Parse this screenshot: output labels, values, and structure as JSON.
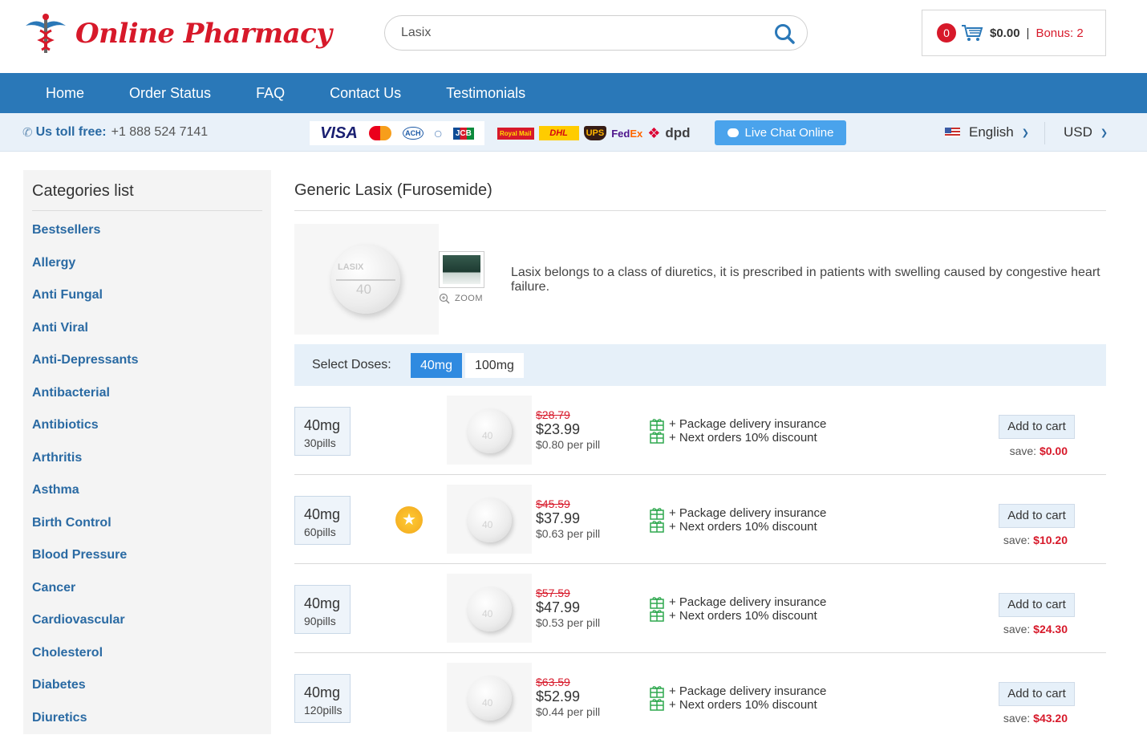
{
  "header": {
    "logo_text": "Online Pharmacy",
    "search": {
      "value": "Lasix"
    },
    "cart": {
      "count": "0",
      "total": "$0.00",
      "separator": "|",
      "bonus": "Bonus: 2"
    }
  },
  "nav": [
    "Home",
    "Order Status",
    "FAQ",
    "Contact Us",
    "Testimonials"
  ],
  "infobar": {
    "toll_label": "Us toll free:",
    "toll_number": "+1 888 524 7141",
    "payment_logos": [
      "VISA",
      "MasterCard",
      "ACH",
      "Diners Club",
      "JCB"
    ],
    "shipping_logos": [
      "Royal Mail",
      "DHL",
      "UPS",
      "FedEx Express",
      "dpd"
    ],
    "live_chat": "Live Chat Online",
    "language": "English",
    "currency": "USD"
  },
  "sidebar": {
    "title": "Categories list",
    "items": [
      "Bestsellers",
      "Allergy",
      "Anti Fungal",
      "Anti Viral",
      "Anti-Depressants",
      "Antibacterial",
      "Antibiotics",
      "Arthritis",
      "Asthma",
      "Birth Control",
      "Blood Pressure",
      "Cancer",
      "Cardiovascular",
      "Cholesterol",
      "Diabetes",
      "Diuretics"
    ]
  },
  "product": {
    "title": "Generic Lasix (Furosemide)",
    "pill_imprint": "LASIX",
    "pill_number": "40",
    "zoom_label": "ZOOM",
    "description": "Lasix belongs to a class of diuretics, it is prescribed in patients with swelling caused by congestive heart failure.",
    "doses_label": "Select Doses:",
    "doses": [
      "40mg",
      "100mg"
    ],
    "selected_dose": "40mg",
    "perk_1": "+ Package delivery insurance",
    "perk_2": "+ Next orders 10% discount",
    "add_to_cart": "Add to cart",
    "save_label": "save:",
    "packages": [
      {
        "dose": "40mg",
        "pills": "30pills",
        "old_price": "$28.79",
        "price": "$23.99",
        "per_pill": "$0.80 per pill",
        "save": "$0.00",
        "bestseller": false
      },
      {
        "dose": "40mg",
        "pills": "60pills",
        "old_price": "$45.59",
        "price": "$37.99",
        "per_pill": "$0.63 per pill",
        "save": "$10.20",
        "bestseller": true
      },
      {
        "dose": "40mg",
        "pills": "90pills",
        "old_price": "$57.59",
        "price": "$47.99",
        "per_pill": "$0.53 per pill",
        "save": "$24.30",
        "bestseller": false
      },
      {
        "dose": "40mg",
        "pills": "120pills",
        "old_price": "$63.59",
        "price": "$52.99",
        "per_pill": "$0.44 per pill",
        "save": "$43.20",
        "bestseller": false
      }
    ]
  },
  "colors": {
    "brand_red": "#d7192a",
    "nav_blue": "#2a78b8",
    "link_blue": "#2a6aa3",
    "accent_blue": "#2f8ae0"
  }
}
